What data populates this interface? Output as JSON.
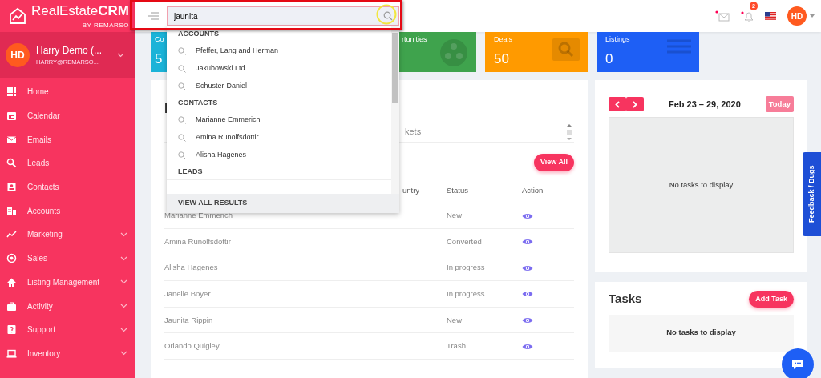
{
  "logo": {
    "text": "RealEstate**CRM**",
    "subtitle": "BY REMARSO"
  },
  "user": {
    "initials": "HD",
    "name": "Harry Demo (...",
    "email": "HARRY@REMARSO..."
  },
  "nav": [
    {
      "label": "Home",
      "kind": "link"
    },
    {
      "label": "Calendar",
      "kind": "link"
    },
    {
      "label": "Emails",
      "kind": "link"
    },
    {
      "label": "Leads",
      "kind": "link"
    },
    {
      "label": "Contacts",
      "kind": "link"
    },
    {
      "label": "Accounts",
      "kind": "link"
    },
    {
      "label": "Marketing",
      "kind": "group"
    },
    {
      "label": "Sales",
      "kind": "group"
    },
    {
      "label": "Listing Management",
      "kind": "group"
    },
    {
      "label": "Activity",
      "kind": "group"
    },
    {
      "label": "Support",
      "kind": "group"
    },
    {
      "label": "Inventory",
      "kind": "group"
    }
  ],
  "search": {
    "value": "jaunita"
  },
  "header": {
    "notifications": "2",
    "avatar": "HD"
  },
  "stat_cards": [
    {
      "label": "Co",
      "value": "5",
      "color": "#1ab3d8"
    },
    {
      "label": "rtunities",
      "color": "#3fa34d"
    },
    {
      "label": "Deals",
      "value": "50",
      "color": "#ff9a00"
    },
    {
      "label": "Listings",
      "value": "0",
      "color": "#1e5ff5"
    }
  ],
  "search_results": {
    "sections": [
      {
        "title": "ACCOUNTS",
        "items": [
          "Pfeffer, Lang and Herman",
          "Jakubowski Ltd",
          "Schuster-Daniel"
        ]
      },
      {
        "title": "CONTACTS",
        "items": [
          "Marianne Emmerich",
          "Amina Runolfsdottir",
          "Alisha Hagenes"
        ]
      },
      {
        "title": "LEADS"
      }
    ],
    "footer": "VIEW ALL RESULTS"
  },
  "leads_panel": {
    "heading_top": "I",
    "select_text": "kets",
    "view_all": "View All",
    "columns": [
      "untry",
      "Status",
      "Action"
    ],
    "rows": [
      {
        "name": "Marianne Emmerich",
        "status": "New"
      },
      {
        "name": "Amina Runolfsdottir",
        "status": "Converted"
      },
      {
        "name": "Alisha Hagenes",
        "status": "In progress"
      },
      {
        "name": "Janelle Boyer",
        "status": "In progress"
      },
      {
        "name": "Jaunita Rippin",
        "status": "New"
      },
      {
        "name": "Orlando Quigley",
        "status": "Trash"
      }
    ]
  },
  "calendar": {
    "range": "Feb 23 – 29, 2020",
    "today": "Today",
    "empty": "No tasks to display"
  },
  "tasks": {
    "title": "Tasks",
    "add": "Add Task",
    "empty": "No tasks to display"
  },
  "feedback": "Feedback / Bugs"
}
